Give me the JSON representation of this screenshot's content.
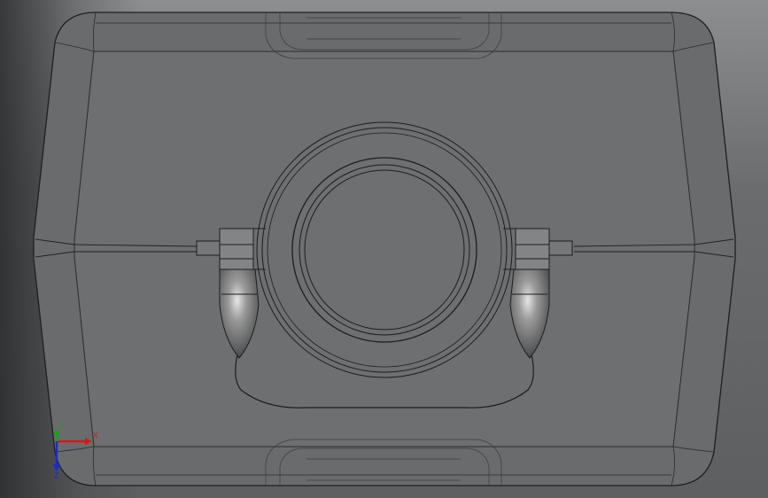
{
  "viewport": {
    "background_top": "#8c8e90",
    "background_bottom": "#5d5f60"
  },
  "model": {
    "body_color": "#6c6d6d",
    "edge_color": "#1e1f20",
    "silhouette_color": "#9a9c9d",
    "bracket_color": "#7e7f80",
    "knob_highlight": "#d8d8d8"
  },
  "triad": {
    "x_label": "X",
    "y_label": "Y",
    "z_label": "Z",
    "x_color": "#d01a1a",
    "y_color": "#1aa01a",
    "z_color": "#1a2ad0"
  }
}
